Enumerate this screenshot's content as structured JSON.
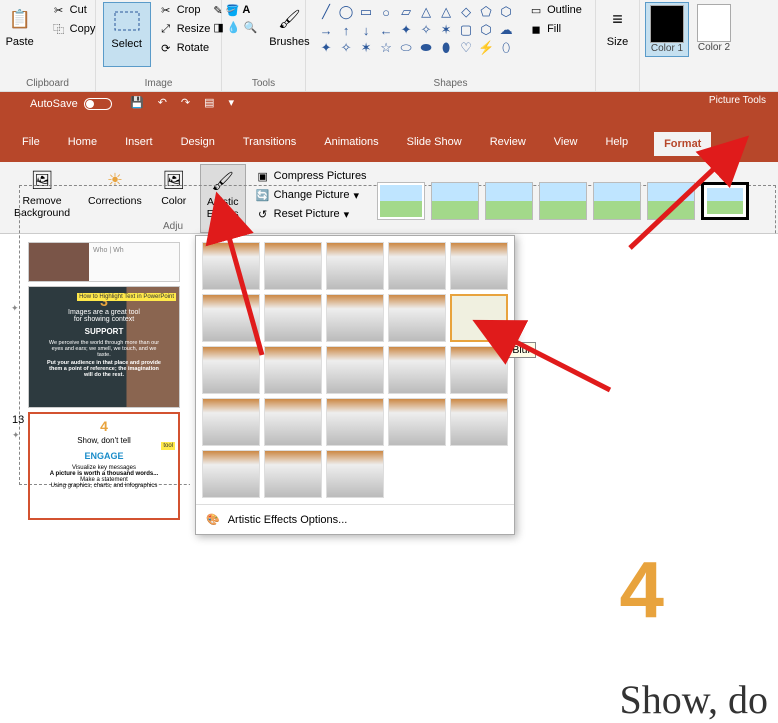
{
  "topRibbon": {
    "clipboard": {
      "paste": "Paste",
      "cut": "Cut",
      "copy": "Copy",
      "label": "Clipboard"
    },
    "image": {
      "select": "Select",
      "crop": "Crop",
      "resize": "Resize",
      "rotate": "Rotate",
      "label": "Image"
    },
    "tools": {
      "brushes": "Brushes",
      "label": "Tools"
    },
    "shapes": {
      "outline": "Outline",
      "fill": "Fill",
      "label": "Shapes"
    },
    "size": {
      "label": "Size"
    },
    "colors": {
      "color1": "Color\n1",
      "color2": "Color\n2"
    }
  },
  "ppt": {
    "autosave": "AutoSave",
    "tabs": [
      "File",
      "Home",
      "Insert",
      "Design",
      "Transitions",
      "Animations",
      "Slide Show",
      "Review",
      "View",
      "Help",
      "Format"
    ],
    "pictureTools": "Picture Tools",
    "subRibbon": {
      "removeBg": "Remove\nBackground",
      "corrections": "Corrections",
      "color": "Color",
      "artisticEffects": "Artistic\nEffects",
      "compress": "Compress Pictures",
      "changePicture": "Change Picture",
      "resetPicture": "Reset Picture",
      "group": "Adju"
    },
    "effectsOptions": "Artistic Effects Options...",
    "blurTooltip": "Blur"
  },
  "slides": {
    "11": {
      "who": "Who | Wh"
    },
    "12": {
      "num": "3",
      "line1": "Images are a great tool",
      "line2": "for showing context",
      "support": "SUPPORT",
      "body": "We perceive the world through more than our eyes and ears; we smell, we touch, and we taste.",
      "body2": "Put your audience in that place and provide them a point of reference; the imagination will do the rest."
    },
    "13": {
      "num": "4",
      "tagline": "Show, don't tell",
      "engage": "ENGAGE",
      "l1": "Visualize key messages",
      "l2": "A picture is worth a thousand words...",
      "l3": "Make a statement",
      "l4": "Using graphics, charts, and infographics"
    }
  },
  "main": {
    "num": "4",
    "headline": "Show, do"
  },
  "annotations_visible": true
}
